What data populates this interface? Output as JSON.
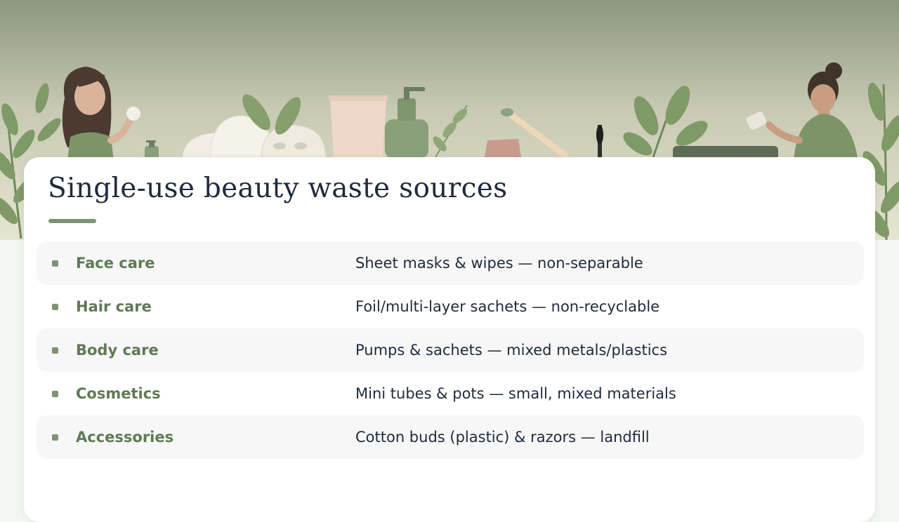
{
  "slide": {
    "title": "Single-use beauty waste sources",
    "accent_color": "#7c9470",
    "rows": [
      {
        "category": "Face care",
        "description": "Sheet masks & wipes — non-separable"
      },
      {
        "category": "Hair care",
        "description": "Foil/multi-layer sachets — non-recyclable"
      },
      {
        "category": "Body care",
        "description": "Pumps & sachets — mixed metals/plastics"
      },
      {
        "category": "Cosmetics",
        "description": "Mini tubes & pots — small, mixed materials"
      },
      {
        "category": "Accessories",
        "description": "Cotton buds (plastic) & razors — landfill"
      }
    ]
  },
  "banner": {
    "illustration": "beauty-products-and-women-illustration",
    "palette": {
      "sky_top": "#8e9882",
      "sky_bottom": "#e4e3cf",
      "leaf": "#7f9a66"
    }
  }
}
